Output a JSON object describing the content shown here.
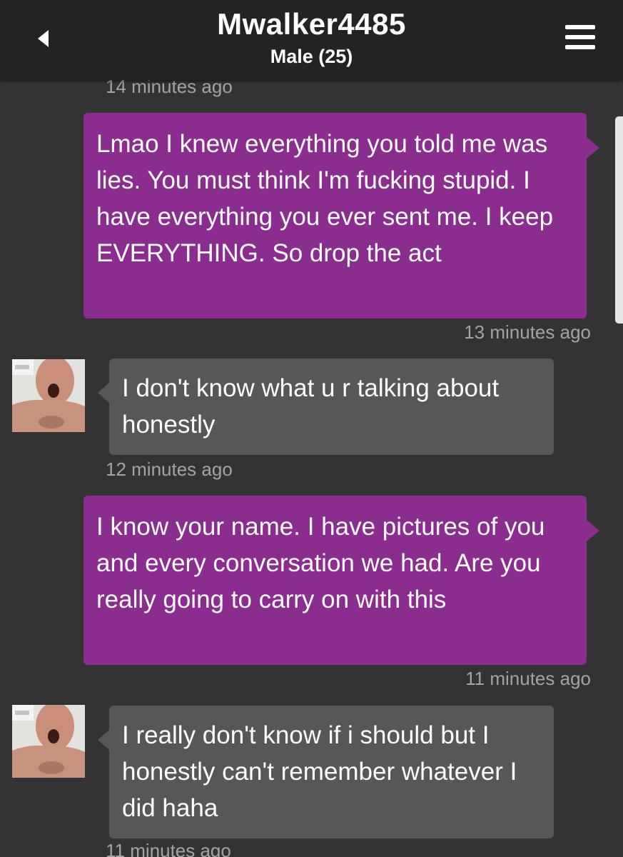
{
  "header": {
    "title": "Mwalker4485",
    "subtitle": "Male (25)",
    "back_icon": "chevron-left-icon",
    "menu_icon": "hamburger-menu-icon"
  },
  "colors": {
    "outgoing_bubble": "#8b2d8e",
    "incoming_bubble": "#575757",
    "background": "#333333",
    "header": "#232323",
    "timestamp": "#a3a3a3"
  },
  "messages": [
    {
      "type": "timestamp",
      "text": "14 minutes ago"
    },
    {
      "type": "outgoing",
      "text": "Lmao I knew everything you told me was lies. You must think I'm fucking stupid. I have everything you ever sent me. I keep EVERYTHING. So drop the act",
      "time": "13 minutes ago"
    },
    {
      "type": "incoming",
      "text": "I don't know what u r talking about honestly",
      "time": "12 minutes ago"
    },
    {
      "type": "outgoing",
      "text": "I know your name. I have pictures of you and every conversation we had. Are you really going to carry on with this",
      "time": "11 minutes ago"
    },
    {
      "type": "incoming",
      "text": "I really don't know if i should but I honestly can't remember whatever I did haha",
      "time": "11 minutes ago"
    }
  ]
}
